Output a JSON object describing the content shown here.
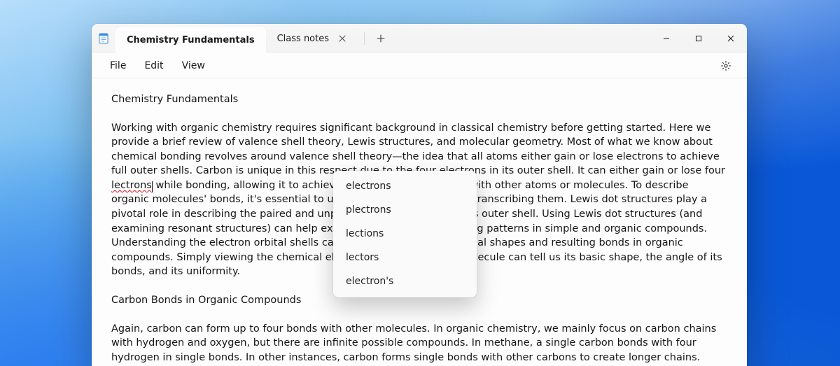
{
  "window": {
    "tabs": [
      {
        "label": "Chemistry Fundamentals",
        "active": true,
        "closable": false
      },
      {
        "label": "Class notes",
        "active": false,
        "closable": true
      }
    ]
  },
  "menubar": {
    "items": [
      "File",
      "Edit",
      "View"
    ]
  },
  "document": {
    "title_line": "Chemistry Fundamentals",
    "p1_before": "Working with organic chemistry requires significant background in classical chemistry before getting started. Here we provide a brief review of valence shell theory, Lewis structures, and molecular geometry. Most of what we know about chemical bonding revolves around valence shell theory—the idea that all atoms either gain or lose electrons to achieve full outer shells. Carbon is unique in this respect due to the four electrons in its outer shell. It can either gain or lose four ",
    "p1_misspelling": "lectrons",
    "p1_after": " while bonding, allowing it to achieve up to four atomic bonds with other atoms or molecules. To describe organic molecules' bonds, it's essential to understand the methods for transcribing them. Lewis dot structures play a pivotal role in describing the paired and unpaired electrons in an atom's outer shell. Using Lewis dot structures (and examining resonant structures) can help explain the shapes and bonding patterns in simple and organic compounds. Understanding the electron orbital shells can help illuminate the eventual shapes and resulting bonds in organic compounds. Simply viewing the chemical elements that comprise a molecule can tell us its basic shape, the angle of its bonds, and its uniformity.",
    "heading2": "Carbon Bonds in Organic Compounds",
    "p2": "Again, carbon can form up to four bonds with other molecules. In organic chemistry, we mainly focus on carbon chains with hydrogen and oxygen, but there are infinite possible compounds. In methane, a single carbon bonds with four hydrogen in single bonds. In other instances, carbon forms single bonds with other carbons to create longer chains."
  },
  "spellcheck": {
    "suggestions": [
      "electrons",
      "plectrons",
      "lections",
      "lectors",
      "electron's"
    ]
  }
}
